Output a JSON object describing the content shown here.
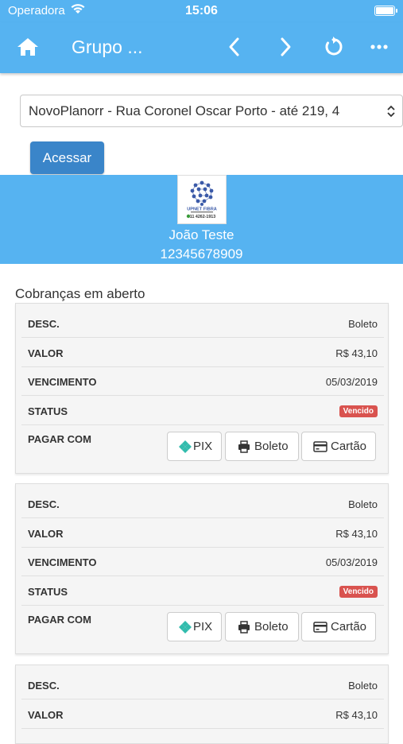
{
  "status_bar": {
    "carrier": "Operadora",
    "time": "15:06"
  },
  "navbar": {
    "title": "Grupo ..."
  },
  "location_select": {
    "value": "NovoPlanorr - Rua Coronel Oscar Porto - até 219, 4"
  },
  "access_button": "Acessar",
  "logo": {
    "brand": "UPNET FIBRA",
    "phone": "11 4262-1913"
  },
  "customer": {
    "name": "João Teste",
    "document": "12345678909"
  },
  "section_title": "Cobranças em aberto",
  "labels": {
    "desc": "DESC.",
    "valor": "VALOR",
    "vencimento": "VENCIMENTO",
    "status": "STATUS",
    "pagar": "PAGAR COM"
  },
  "pay_labels": {
    "pix": "PIX",
    "boleto": "Boleto",
    "cartao": "Cartão"
  },
  "charges": [
    {
      "desc": "Boleto",
      "valor": "R$ 43,10",
      "vencimento": "05/03/2019",
      "status": "Vencido"
    },
    {
      "desc": "Boleto",
      "valor": "R$ 43,10",
      "vencimento": "05/03/2019",
      "status": "Vencido"
    },
    {
      "desc": "Boleto",
      "valor": "R$ 43,10"
    }
  ],
  "colors": {
    "primary": "#56b3f1",
    "button": "#3a85c9",
    "badge": "#d9534f",
    "pix": "#32bcad"
  }
}
